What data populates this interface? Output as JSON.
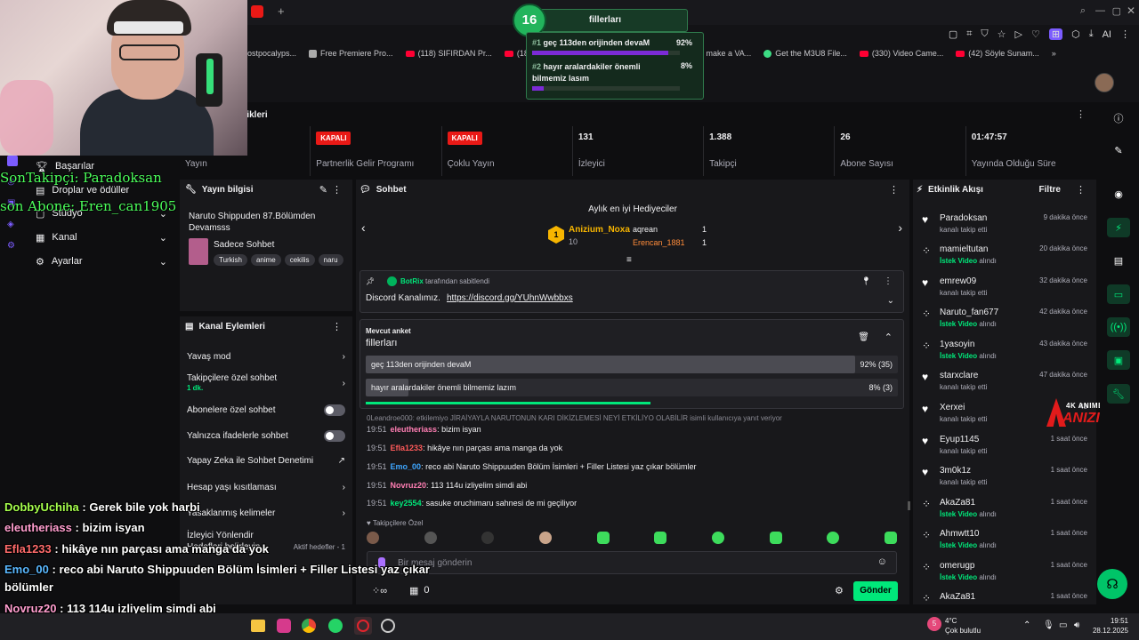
{
  "browser": {
    "bookmarks": [
      "ostpocalyps...",
      "Free Premiere Pro...",
      "(118) SIFIRDAN Pr...",
      "(186)",
      "o make a VA...",
      "Get the M3U8 File...",
      "(330) Video Came...",
      "(42) Söyle Sunam..."
    ],
    "ai_label": "AI"
  },
  "poll_popup": {
    "count": "16",
    "title": "fillerları",
    "option1_rank": "#1",
    "option1_text": "geç 113den orijinden devaM",
    "option1_pct": "92%",
    "option1_fill": 0.92,
    "option2_rank": "#2",
    "option2_text": "hayır aralardakiler önemli bilmemiz lasım",
    "option2_pct": "8%",
    "option2_fill": 0.08
  },
  "dashboard": {
    "title_partial": "tikleri",
    "stats": [
      {
        "value": "",
        "label": "Yayın"
      },
      {
        "badge": "KAPALI",
        "label": "Partnerlik Gelir Programı"
      },
      {
        "badge": "KAPALI",
        "label": "Çoklu Yayın"
      },
      {
        "value": "131",
        "label": "İzleyici"
      },
      {
        "value": "1.388",
        "label": "Takipçi"
      },
      {
        "value": "26",
        "label": "Abone Sayısı"
      },
      {
        "value": "01:47:57",
        "label": "Yayında Olduğu Süre"
      }
    ]
  },
  "sidebar": {
    "items": [
      "Başarılar",
      "Droplar ve ödüller",
      "Stüdyo",
      "Kanal",
      "Ayarlar"
    ]
  },
  "overlay": {
    "last_follower": "SonTakipçi: Paradoksan",
    "last_sub": "son Abone: Eren_can1905"
  },
  "stream_info": {
    "title": "Yayın bilgisi",
    "stream_title": "Naruto Shippuden 87.Bölümden Devamsss",
    "category": "Sadece Sohbet",
    "tags": [
      "Turkish",
      "anime",
      "cekilis",
      "naru"
    ]
  },
  "channel_actions": {
    "title": "Kanal Eylemleri",
    "rows": [
      {
        "label": "Yavaş mod"
      },
      {
        "label": "Takipçilere özel sohbet",
        "sub": "1 dk."
      },
      {
        "label": "Abonelere özel sohbet"
      },
      {
        "label": "Yalnızca ifadelerle sohbet"
      },
      {
        "label": "Yapay Zeka ile Sohbet Denetimi"
      },
      {
        "label": "Hesap yaşı kısıtlaması"
      },
      {
        "label": "Yasaklanmış kelimeler"
      },
      {
        "label": "İzleyici Yönlendir"
      }
    ],
    "goals_label": "Hedefleri belirleyin",
    "active_goals": "Aktif hedefler - 1"
  },
  "chat": {
    "title": "Sohbet",
    "top_gifters_title": "Aylık en iyi Hediyeciler",
    "gifters": [
      {
        "name": "Anizium_Noxa",
        "count": "10"
      },
      {
        "name": "aqrean",
        "count": "1"
      },
      {
        "name": "Erencan_1881",
        "count": "1"
      }
    ],
    "pinned_by": "BotRix",
    "pinned_suffix": "tarafından sabitlendi",
    "pinned_text": "Discord Kanalımız.",
    "pinned_link": "https://discord.gg/YUhnWwbbxs",
    "poll_label": "Mevcut anket",
    "poll_title": "fillerları",
    "poll_options": [
      {
        "text": "geç 113den orijinden devaM",
        "result": "92% (35)",
        "fill": 0.92
      },
      {
        "text": "hayır aralardakiler önemli bilmemiz lazım",
        "result": "8% (3)",
        "fill": 0.08
      }
    ],
    "reply_note": "0Leandroe000: etkilemiyo JİRAİYAYLA NARUTONUN KARI DİKİZLEMESİ NEYİ ETKİLİYO OLABİLİR isimli kullanıcıya yanıt veriyor",
    "messages": [
      {
        "time": "19:51",
        "user": "eleutheriass",
        "color": "#ff7eb3",
        "text": "bizim isyan"
      },
      {
        "time": "19:51",
        "user": "Efla1233",
        "color": "#ff5a5a",
        "text": "hikâye nın parçası ama manga da yok"
      },
      {
        "time": "19:51",
        "user": "Emo_00",
        "color": "#3ea6ff",
        "text": "reco abi Naruto Shippuuden Bölüm İsimleri + Filler Listesi yaz çıkar bölümler"
      },
      {
        "time": "19:51",
        "user": "Novruz20",
        "color": "#ff7eb3",
        "text": "113 114u izliyelim simdi abi"
      },
      {
        "time": "19:51",
        "user": "key2554",
        "color": "#00e87a",
        "text": "sasuke oruchimaru sahnesi de mi geçiliyor"
      }
    ],
    "followers_only": "Takipçilere Özel",
    "input_placeholder": "Bir mesaj gönderin",
    "points": "0",
    "send_label": "Gönder"
  },
  "activity": {
    "title": "Etkinlik Akışı",
    "filter": "Filtre",
    "items": [
      {
        "name": "Paradoksan",
        "sub": "kanalı takip etti",
        "time": "9 dakika önce",
        "type": "follow"
      },
      {
        "name": "mamieltutan",
        "sub": "İstek Video",
        "sub2": "alındı",
        "time": "20 dakika önce",
        "type": "req"
      },
      {
        "name": "emrew09",
        "sub": "kanalı takip etti",
        "time": "32 dakika önce",
        "type": "follow"
      },
      {
        "name": "Naruto_fan677",
        "sub": "İstek Video",
        "sub2": "alındı",
        "time": "42 dakika önce",
        "type": "req"
      },
      {
        "name": "1yasoyin",
        "sub": "İstek Video",
        "sub2": "alındı",
        "time": "43 dakika önce",
        "type": "req"
      },
      {
        "name": "starxclare",
        "sub": "kanalı takip etti",
        "time": "47 dakika önce",
        "type": "follow"
      },
      {
        "name": "Xerxei",
        "sub": "kanalı takip etti",
        "time": "48",
        "type": "follow"
      },
      {
        "name": "Eyup1145",
        "sub": "kanalı takip etti",
        "time": "1 saat önce",
        "type": "follow"
      },
      {
        "name": "3m0k1z",
        "sub": "kanalı takip etti",
        "time": "1 saat önce",
        "type": "follow"
      },
      {
        "name": "AkaZa81",
        "sub": "İstek Video",
        "sub2": "alındı",
        "time": "1 saat önce",
        "type": "req"
      },
      {
        "name": "Ahmwtt10",
        "sub": "İstek Video",
        "sub2": "alındı",
        "time": "1 saat önce",
        "type": "req"
      },
      {
        "name": "omerugp",
        "sub": "İstek Video",
        "sub2": "alındı",
        "time": "1 saat önce",
        "type": "req"
      },
      {
        "name": "AkaZa81",
        "sub": "",
        "time": "1 saat önce",
        "type": "req"
      }
    ]
  },
  "logo": {
    "top": "4K ANIME MOVIE",
    "name": "ANIZIUM"
  },
  "overlay_chat": [
    {
      "user": "DobbyUchiha",
      "color": "#a6ff4d",
      "text": ": Gerek bile yok harbi"
    },
    {
      "user": "eleutheriass",
      "color": "#ff9ecf",
      "text": ": bizim isyan"
    },
    {
      "user": "Efla1233",
      "color": "#ff6b6b",
      "text": ": hikâye nın parçası ama manga da yok"
    },
    {
      "user": "Emo_00",
      "color": "#5ab8ff",
      "text": ": reco abi Naruto Shippuuden Bölüm İsimleri + Filler Listesi yaz çıkar"
    },
    {
      "user": "",
      "color": "#ffffff",
      "text": "bölümler"
    },
    {
      "user": "Novruz20",
      "color": "#ff9ecf",
      "text": ": 113 114u izliyelim simdi abi"
    },
    {
      "user": "key2554",
      "color": "#5dff8a",
      "text": ": sasuke oruchimaru sahnesi de mi geçiliyor"
    }
  ],
  "taskbar": {
    "temp": "4°C",
    "weather": "Çok bulutlu",
    "time": "19:51",
    "date": "28.12.2025",
    "weather_badge": "5"
  }
}
